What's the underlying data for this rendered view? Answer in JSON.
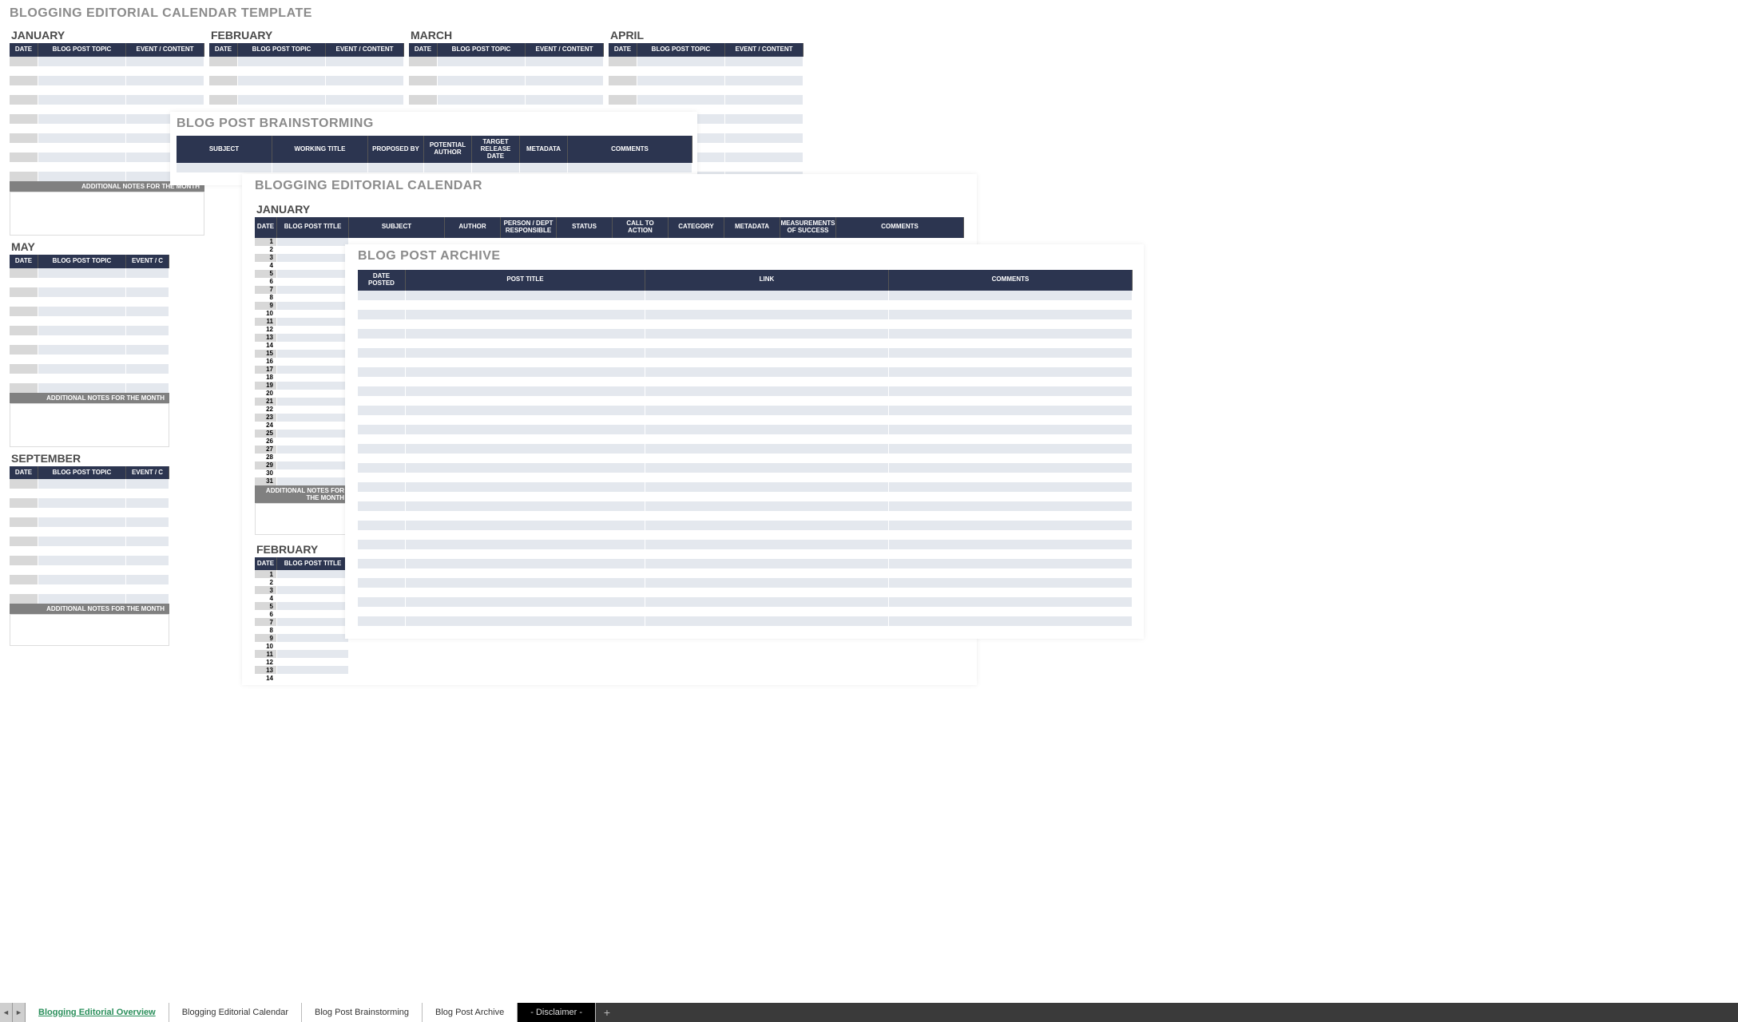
{
  "template": {
    "title": "BLOGGING EDITORIAL CALENDAR TEMPLATE",
    "months": [
      "JANUARY",
      "FEBRUARY",
      "MARCH",
      "APRIL",
      "MAY",
      "SEPTEMBER"
    ],
    "cols": [
      "DATE",
      "BLOG POST TOPIC",
      "EVENT / CONTENT"
    ],
    "cols_trunc": [
      "DATE",
      "BLOG POST TOPIC",
      "EVENT / C"
    ],
    "notes_label": "ADDITIONAL NOTES FOR THE MONTH"
  },
  "brainstorm": {
    "title": "BLOG POST BRAINSTORMING",
    "cols": [
      "SUBJECT",
      "WORKING TITLE",
      "PROPOSED BY",
      "POTENTIAL AUTHOR",
      "TARGET RELEASE DATE",
      "METADATA",
      "COMMENTS"
    ]
  },
  "calendar": {
    "title": "BLOGGING EDITORIAL CALENDAR",
    "months": [
      "JANUARY",
      "FEBRUARY"
    ],
    "cols": [
      "DATE",
      "BLOG POST TITLE",
      "SUBJECT",
      "AUTHOR",
      "PERSON / DEPT RESPONSIBLE",
      "STATUS",
      "CALL TO ACTION",
      "CATEGORY",
      "METADATA",
      "MEASUREMENTS OF SUCCESS",
      "COMMENTS"
    ],
    "cols_short": [
      "DATE",
      "BLOG POST TITLE"
    ],
    "notes_label": "ADDITIONAL NOTES FOR THE MONTH",
    "jan_days": 31,
    "feb_days_visible": 14
  },
  "archive": {
    "title": "BLOG POST ARCHIVE",
    "cols": [
      "DATE POSTED",
      "POST TITLE",
      "LINK",
      "COMMENTS"
    ],
    "rows": 36
  },
  "tabs": {
    "items": [
      {
        "label": "Blogging Editorial Overview",
        "active": true
      },
      {
        "label": "Blogging Editorial Calendar",
        "active": false
      },
      {
        "label": "Blog Post Brainstorming",
        "active": false
      },
      {
        "label": "Blog Post Archive",
        "active": false
      },
      {
        "label": "- Disclaimer -",
        "active": false,
        "dark": true
      }
    ]
  }
}
